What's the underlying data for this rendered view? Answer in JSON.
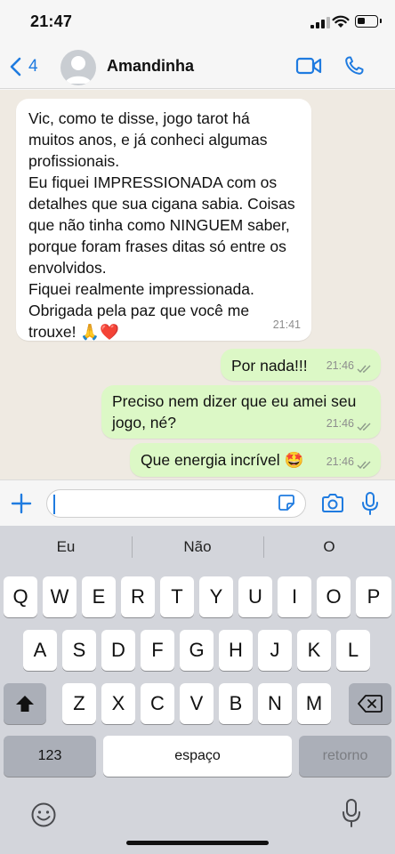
{
  "status_bar": {
    "time": "21:47"
  },
  "header": {
    "back_count": "4",
    "contact_name": "Amandinha"
  },
  "messages": [
    {
      "direction": "incoming",
      "text": "Vic, como te disse, jogo tarot há\nmuitos anos, e já conheci algumas\nprofissionais.\nEu fiquei IMPRESSIONADA com os\ndetalhes que sua cigana sabia. Coisas\nque não tinha como NINGUEM saber,\nporque foram frases ditas só entre os\nenvolvidos.\nFiquei realmente impressionada.\nObrigada pela paz que você me\ntrouxe! 🙏❤️",
      "time": "21:41"
    },
    {
      "direction": "outgoing",
      "text": "Por nada!!!",
      "time": "21:46",
      "status": "read"
    },
    {
      "direction": "outgoing",
      "text": "Preciso nem dizer que eu amei seu\njogo,  né?",
      "time": "21:46",
      "status": "read"
    },
    {
      "direction": "outgoing",
      "text": "Que energia incrível 🤩",
      "time": "21:46",
      "status": "read"
    }
  ],
  "input": {
    "value": "",
    "placeholder": ""
  },
  "keyboard": {
    "suggestions": [
      "Eu",
      "Não",
      "O"
    ],
    "row1": [
      "Q",
      "W",
      "E",
      "R",
      "T",
      "Y",
      "U",
      "I",
      "O",
      "P"
    ],
    "row2": [
      "A",
      "S",
      "D",
      "F",
      "G",
      "H",
      "J",
      "K",
      "L"
    ],
    "row3": [
      "Z",
      "X",
      "C",
      "V",
      "B",
      "N",
      "M"
    ],
    "numbers_label": "123",
    "space_label": "espaço",
    "return_label": "retorno"
  },
  "colors": {
    "accent": "#1f7be0",
    "incoming_bubble": "#ffffff",
    "outgoing_bubble": "#dcf8c6",
    "chat_background": "#efeae2"
  },
  "icons": [
    "back-chevron-icon",
    "avatar-placeholder-icon",
    "video-call-icon",
    "phone-call-icon",
    "plus-icon",
    "sticker-icon",
    "camera-icon",
    "microphone-icon",
    "shift-icon",
    "backspace-icon",
    "emoji-icon",
    "dictation-icon"
  ]
}
